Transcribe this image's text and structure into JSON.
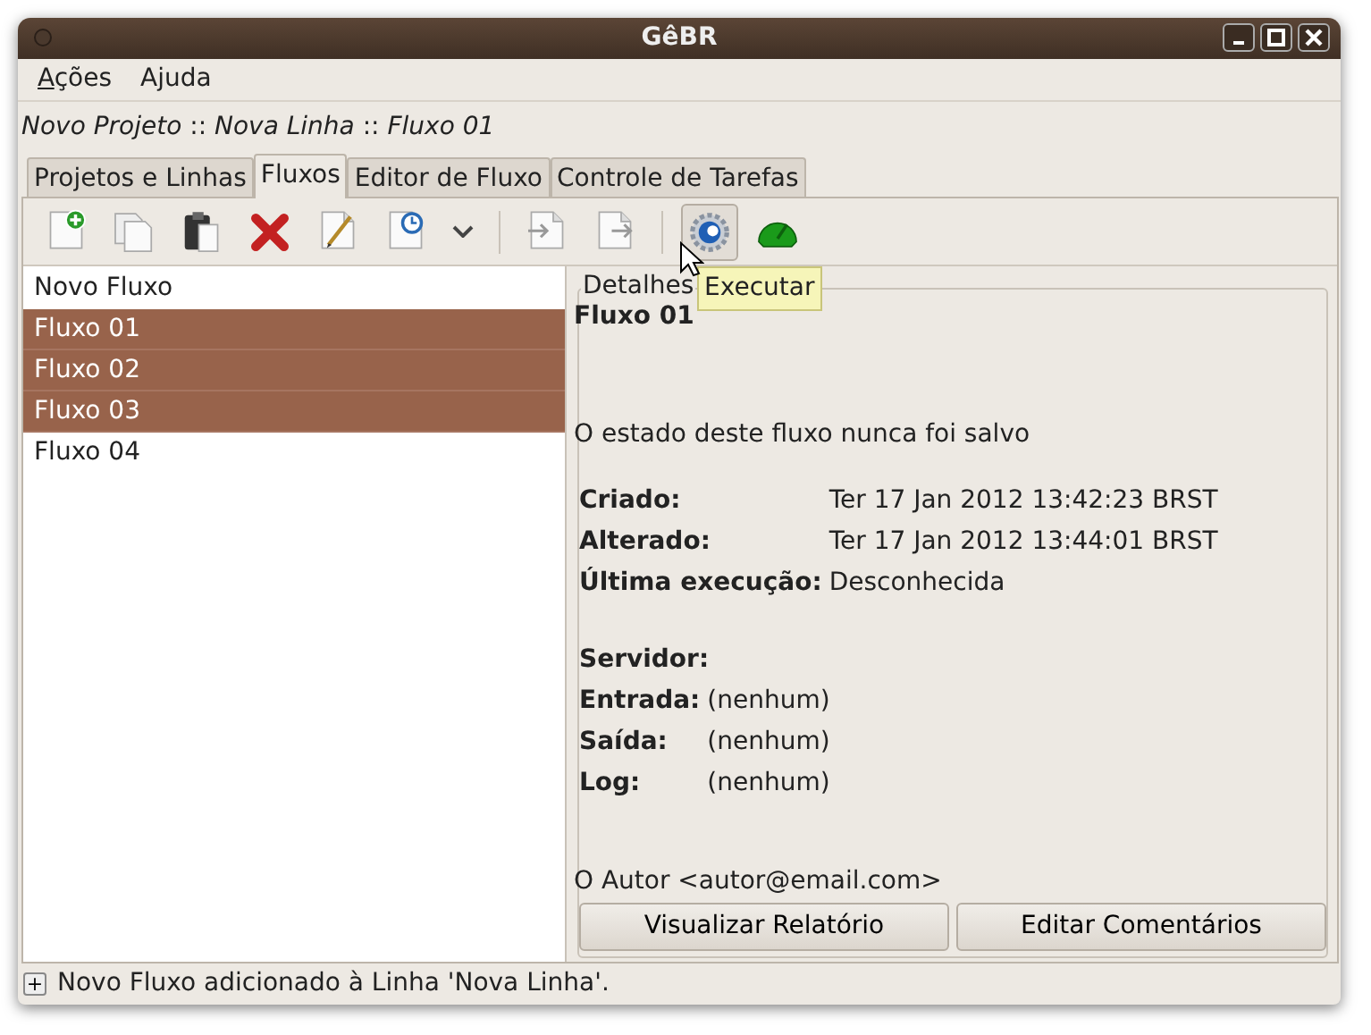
{
  "window": {
    "title": "GêBR"
  },
  "menu": [
    {
      "key": "A",
      "rest": "ções"
    },
    {
      "lead": "A",
      "key": "j",
      "rest": "uda"
    }
  ],
  "breadcrumb": "*Novo Projeto* :: *Nova Linha* :: *Fluxo 01*",
  "tabs": [
    {
      "label": "Projetos e Linhas",
      "selected": false
    },
    {
      "label": "Fluxos",
      "selected": true
    },
    {
      "label": "Editor de Fluxo",
      "selected": false
    },
    {
      "label": "Controle de Tarefas",
      "selected": false
    }
  ],
  "toolbar": [
    {
      "kind": "tool",
      "hovered": false
    },
    {
      "kind": "tool",
      "hovered": false
    },
    {
      "kind": "tool",
      "hovered": false
    },
    {
      "kind": "tool",
      "hovered": false
    },
    {
      "kind": "tool",
      "hovered": false
    },
    {
      "kind": "tool",
      "hovered": false
    },
    {
      "kind": "dropdown",
      "hovered": false
    },
    {
      "kind": "separator"
    },
    {
      "kind": "tool",
      "hovered": false
    },
    {
      "kind": "tool",
      "hovered": false
    },
    {
      "kind": "separator"
    },
    {
      "kind": "tool",
      "hovered": true
    },
    {
      "kind": "tool",
      "hovered": false
    }
  ],
  "tooltip": "Executar",
  "flows": [
    {
      "label": "Novo Fluxo",
      "selected": false
    },
    {
      "label": "Fluxo 01",
      "selected": true
    },
    {
      "label": "Fluxo 02",
      "selected": true
    },
    {
      "label": "Fluxo 03",
      "selected": true
    },
    {
      "label": "Fluxo 04",
      "selected": false
    }
  ],
  "details": {
    "legend": "Detalhes",
    "title": "Fluxo 01",
    "state": "O estado deste fluxo nunca foi salvo",
    "dates": [
      {
        "label": "Criado:",
        "value": "Ter 17 Jan 2012 13:42:23 BRST"
      },
      {
        "label": "Alterado:",
        "value": "Ter 17 Jan 2012 13:44:01 BRST"
      },
      {
        "label": "Última execução:",
        "value": "Desconhecida"
      }
    ],
    "server_label": "Servidor:",
    "io": [
      {
        "label": "Entrada:",
        "value": "(nenhum)"
      },
      {
        "label": "Saída:",
        "value": "(nenhum)"
      },
      {
        "label": "Log:",
        "value": "(nenhum)"
      }
    ],
    "author": "O Autor <autor@email.com>",
    "buttons": [
      "Visualizar Relatório",
      "Editar Comentários"
    ]
  },
  "status_bar": {
    "expander": "+",
    "message": "Novo Fluxo adicionado à Linha 'Nova Linha'."
  }
}
